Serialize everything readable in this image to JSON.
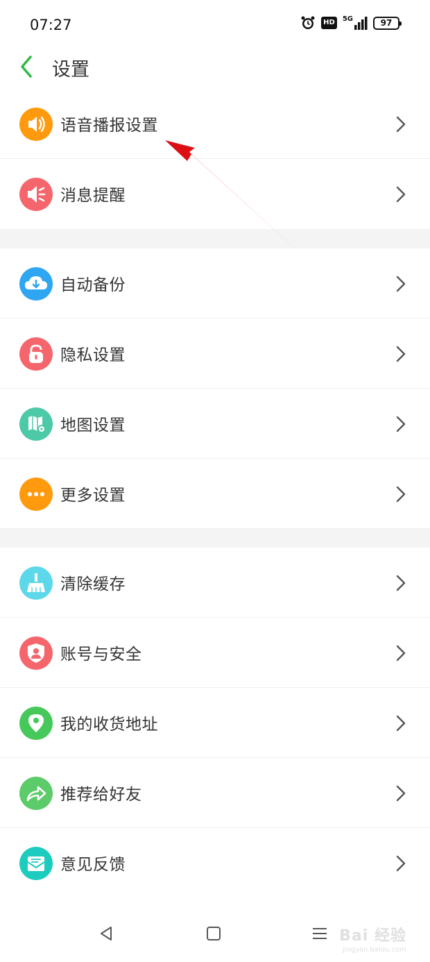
{
  "status_bar": {
    "time": "07:27",
    "hd_label": "HD",
    "network_label": "5G",
    "battery_level": "97"
  },
  "header": {
    "title": "设置",
    "accent_color": "#2fb844"
  },
  "settings": [
    {
      "label": "语音播报设置",
      "icon": "speaker-icon",
      "color": "#ff9a0e"
    },
    {
      "label": "消息提醒",
      "icon": "megaphone-icon",
      "color": "#f4666c"
    },
    {
      "label": "自动备份",
      "icon": "cloud-download-icon",
      "color": "#2fa6f2"
    },
    {
      "label": "隐私设置",
      "icon": "lock-icon",
      "color": "#f4666c"
    },
    {
      "label": "地图设置",
      "icon": "map-settings-icon",
      "color": "#4cc9a6"
    },
    {
      "label": "更多设置",
      "icon": "more-dots-icon",
      "color": "#ff9a0e"
    },
    {
      "label": "清除缓存",
      "icon": "broom-icon",
      "color": "#5cd8ea"
    },
    {
      "label": "账号与安全",
      "icon": "shield-user-icon",
      "color": "#f4666c"
    },
    {
      "label": "我的收货地址",
      "icon": "location-pin-icon",
      "color": "#46c95a"
    },
    {
      "label": "推荐给好友",
      "icon": "share-arrow-icon",
      "color": "#5ccb6a"
    },
    {
      "label": "意见反馈",
      "icon": "envelope-icon",
      "color": "#1ecbbf"
    }
  ],
  "annotation": {
    "arrow_color": "#e8171c"
  },
  "watermark": {
    "main": "Bai 经验",
    "sub": "jingyan.baidu.com"
  }
}
